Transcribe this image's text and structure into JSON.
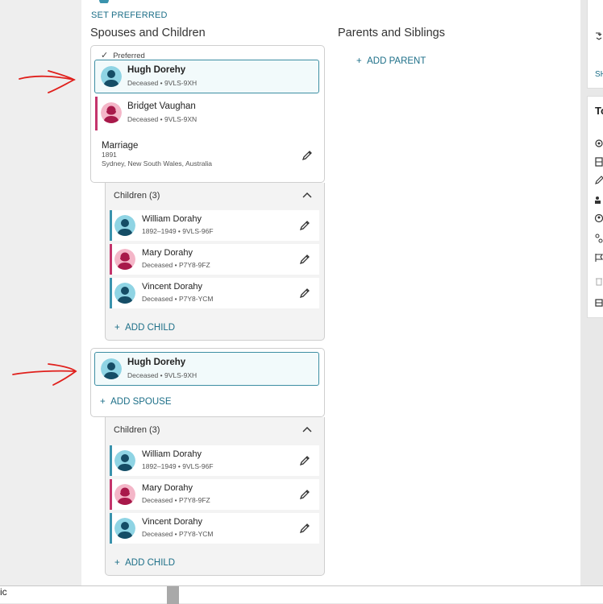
{
  "colors": {
    "link": "#1d6f88",
    "male_bar": "#3a93ad",
    "female_bar": "#c4346c",
    "selected_border": "#3d8ea3",
    "annotation_arrow": "#e0201c"
  },
  "set_preferred_label": "SET PREFERRED",
  "spouses_title": "Spouses and Children",
  "parents_title": "Parents and Siblings",
  "add_parent_label": "ADD PARENT",
  "family1": {
    "preferred_label": "Preferred",
    "husband": {
      "name": "Hugh Dorehy",
      "meta": "Deceased • 9VLS-9XH",
      "icon": "male-avatar-icon"
    },
    "wife": {
      "name": "Bridget Vaughan",
      "meta": "Deceased • 9VLS-9XN",
      "icon": "female-avatar-icon"
    },
    "marriage": {
      "label": "Marriage",
      "year": "1891",
      "place": "Sydney, New South Wales, Australia"
    },
    "children_label": "Children (3)",
    "children": [
      {
        "name": "William Dorahy",
        "meta": "1892–1949 • 9VLS-96F",
        "sex": "male"
      },
      {
        "name": "Mary Dorahy",
        "meta": "Deceased • P7Y8-9FZ",
        "sex": "female"
      },
      {
        "name": "Vincent Dorahy",
        "meta": "Deceased • P7Y8-YCM",
        "sex": "male"
      }
    ],
    "add_child_label": "ADD CHILD"
  },
  "family2": {
    "husband": {
      "name": "Hugh Dorehy",
      "meta": "Deceased • 9VLS-9XH",
      "icon": "male-avatar-icon"
    },
    "add_spouse_label": "ADD SPOUSE",
    "children_label": "Children (3)",
    "children": [
      {
        "name": "William Dorahy",
        "meta": "1892–1949 • 9VLS-96F",
        "sex": "male"
      },
      {
        "name": "Mary Dorahy",
        "meta": "Deceased • P7Y8-9FZ",
        "sex": "female"
      },
      {
        "name": "Vincent Dorahy",
        "meta": "Deceased • P7Y8-YCM",
        "sex": "male"
      }
    ],
    "add_child_label": "ADD CHILD"
  },
  "right_panel": {
    "partial_link": "SH",
    "partial_title": "To"
  },
  "bottom_partial_text": "ic"
}
